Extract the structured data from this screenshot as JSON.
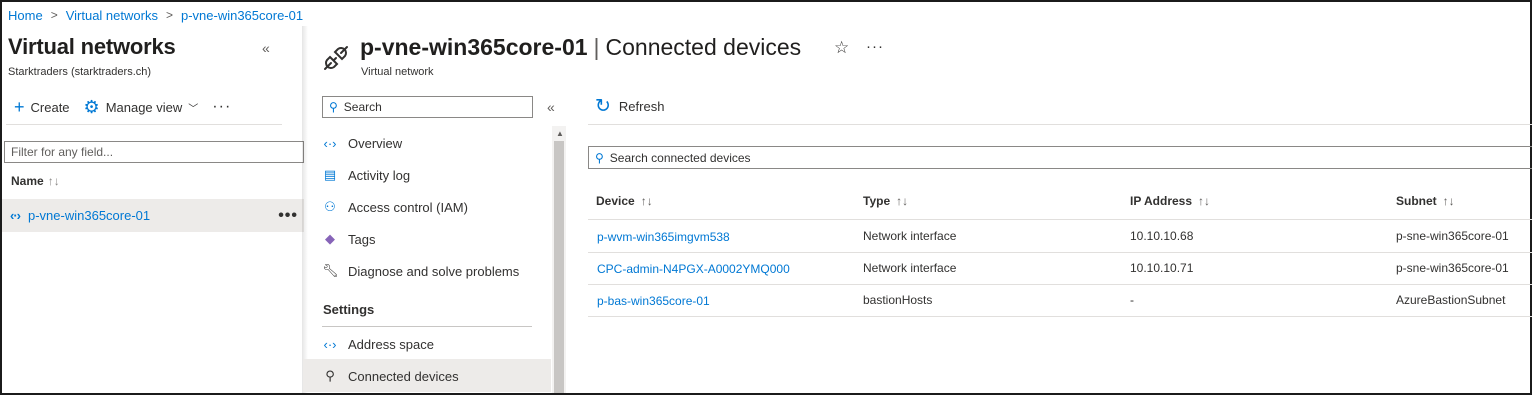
{
  "breadcrumb": {
    "items": [
      "Home",
      "Virtual networks",
      "p-vne-win365core-01"
    ],
    "separator": ">"
  },
  "left_blade": {
    "title": "Virtual networks",
    "subtitle": "Starktraders (starktraders.ch)",
    "collapse_glyph": "«",
    "toolbar": {
      "create_label": "Create",
      "manage_view_label": "Manage view",
      "more_glyph": "···"
    },
    "filter_placeholder": "Filter for any field...",
    "column_name": "Name",
    "column_sort_glyph": "↑↓",
    "rows": [
      {
        "name": "p-vne-win365core-01",
        "more_glyph": "•••"
      }
    ]
  },
  "header": {
    "resource_name": "p-vne-win365core-01",
    "separator": "|",
    "page_name": "Connected devices",
    "resource_type": "Virtual network",
    "star_glyph": "☆",
    "more_glyph": "···"
  },
  "menu": {
    "search_placeholder": "Search",
    "collapse_glyph": "«",
    "items": [
      {
        "label": "Overview",
        "icon": "virtual-network-icon"
      },
      {
        "label": "Activity log",
        "icon": "activity-log-icon"
      },
      {
        "label": "Access control (IAM)",
        "icon": "people-icon"
      },
      {
        "label": "Tags",
        "icon": "tag-icon"
      },
      {
        "label": "Diagnose and solve problems",
        "icon": "wrench-icon"
      }
    ],
    "section_settings": "Settings",
    "settings_items": [
      {
        "label": "Address space",
        "icon": "virtual-network-icon"
      },
      {
        "label": "Connected devices",
        "icon": "plug-icon",
        "active": true
      }
    ]
  },
  "content": {
    "refresh_label": "Refresh",
    "search_placeholder": "Search connected devices",
    "columns": [
      {
        "label": "Device",
        "sort": "↑↓"
      },
      {
        "label": "Type",
        "sort": "↑↓"
      },
      {
        "label": "IP Address",
        "sort": "↑↓"
      },
      {
        "label": "Subnet",
        "sort": "↑↓"
      }
    ],
    "rows": [
      {
        "device": "p-wvm-win365imgvm538",
        "type": "Network interface",
        "ip": "10.10.10.68",
        "subnet": "p-sne-win365core-01"
      },
      {
        "device": "CPC-admin-N4PGX-A0002YMQ000",
        "type": "Network interface",
        "ip": "10.10.10.71",
        "subnet": "p-sne-win365core-01"
      },
      {
        "device": "p-bas-win365core-01",
        "type": "bastionHosts",
        "ip": "-",
        "subnet": "AzureBastionSubnet"
      }
    ]
  },
  "colors": {
    "accent": "#0078d4",
    "selected_row": "#edebe9",
    "text": "#323130"
  }
}
